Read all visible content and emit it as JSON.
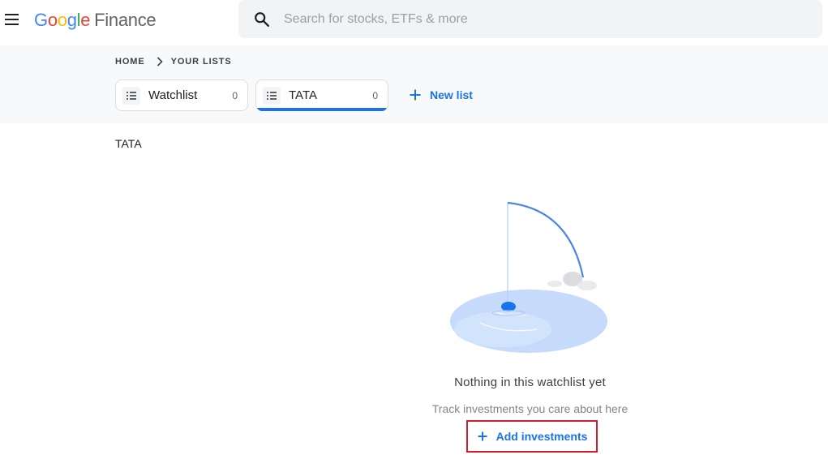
{
  "app": {
    "logo_google": [
      "G",
      "o",
      "o",
      "g",
      "l",
      "e"
    ],
    "logo_colors": [
      "#4285F4",
      "#EA4335",
      "#FBBC05",
      "#4285F4",
      "#34A853",
      "#EA4335"
    ],
    "logo_product": "Finance"
  },
  "search": {
    "placeholder": "Search for stocks, ETFs & more",
    "value": ""
  },
  "breadcrumb": {
    "home": "HOME",
    "current": "YOUR LISTS"
  },
  "lists": [
    {
      "label": "Watchlist",
      "count": "0",
      "active": false
    },
    {
      "label": "TATA",
      "count": "0",
      "active": true
    }
  ],
  "new_list_label": "New list",
  "main": {
    "list_title": "TATA",
    "empty_title": "Nothing in this watchlist yet",
    "empty_subtitle": "Track investments you care about here",
    "add_button_label": "Add investments"
  },
  "colors": {
    "accent": "#1a73e8",
    "highlight_border": "#d0202e"
  }
}
